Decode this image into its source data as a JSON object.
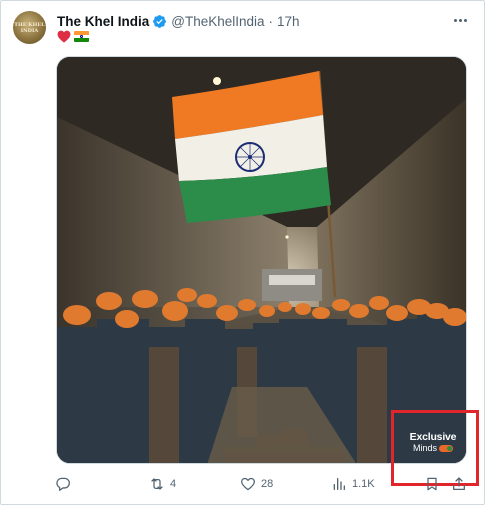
{
  "tweet": {
    "author_name": "The Khel India",
    "handle": "@TheKhelIndia",
    "separator": "·",
    "time": "17h",
    "verified": true,
    "avatar_text": "THE KHEL INDIA",
    "emojis": [
      "red-heart",
      "india-flag"
    ],
    "media": {
      "watermark_line1": "Exclusive",
      "watermark_line2": "Minds"
    },
    "actions": {
      "reply_count": "",
      "retweet_count": "4",
      "like_count": "28",
      "views_count": "1.1K"
    }
  },
  "colors": {
    "verified_blue": "#1d9bf0",
    "text_secondary": "#536471",
    "highlight_red": "#e0252b",
    "saffron": "#ff9933",
    "india_green": "#138808"
  }
}
